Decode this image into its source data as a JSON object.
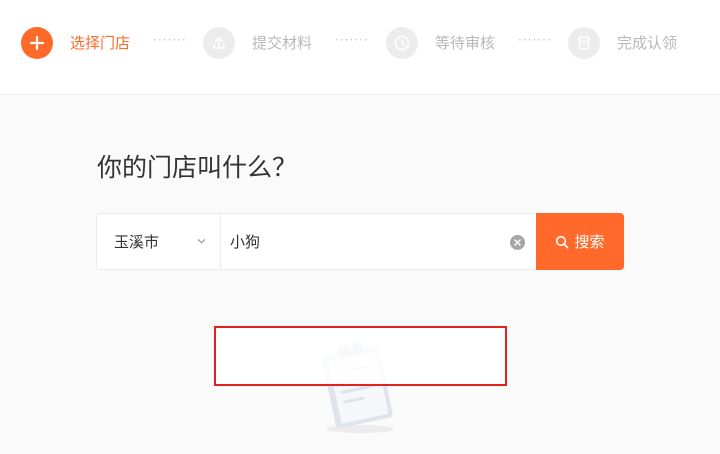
{
  "steps": [
    {
      "label": "选择门店",
      "icon": "plus-icon",
      "active": true
    },
    {
      "label": "提交材料",
      "icon": "upload-icon",
      "active": false
    },
    {
      "label": "等待审核",
      "icon": "clock-icon",
      "active": false
    },
    {
      "label": "完成认领",
      "icon": "document-icon",
      "active": false
    }
  ],
  "step_separator": "·······",
  "question": "你的门店叫什么？",
  "search": {
    "city": "玉溪市",
    "query": "小狗",
    "button_label": "搜索"
  },
  "colors": {
    "accent": "#ff6a2a",
    "inactive": "#ececec",
    "highlight": "#e1221f"
  }
}
